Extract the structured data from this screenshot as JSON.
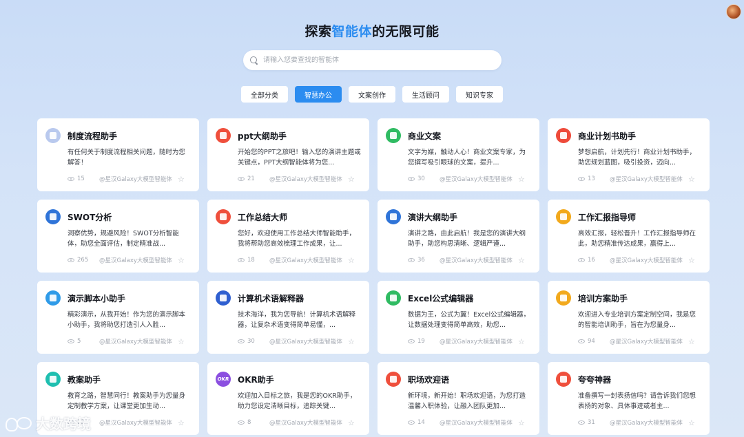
{
  "header": {
    "title_pre": "探索",
    "title_highlight": "智能体",
    "title_post": "的无限可能"
  },
  "search": {
    "placeholder": "请输入您要查找的智能体"
  },
  "tabs": [
    {
      "label": "全部分类",
      "active": false
    },
    {
      "label": "智慧办公",
      "active": true
    },
    {
      "label": "文案创作",
      "active": false
    },
    {
      "label": "生活顾问",
      "active": false
    },
    {
      "label": "知识专家",
      "active": false
    }
  ],
  "cards": [
    {
      "title": "制度流程助手",
      "desc": "有任何关于制度流程相关问题，随时为您解答！",
      "views": "15",
      "author": "@星汉Galaxy大模型智能体",
      "icon": "robot-icon",
      "color": "#b9c9ee"
    },
    {
      "title": "ppt大纲助手",
      "desc": "开始您的PPT之旅吧！输入您的演讲主题或关键点，PPT大纲智能体将为您...",
      "views": "21",
      "author": "@星汉Galaxy大模型智能体",
      "icon": "ppt-icon",
      "color": "#ef4f3c"
    },
    {
      "title": "商业文案",
      "desc": "文字为媒，触动人心！商业文案专家，为您撰写吸引眼球的文案，提升...",
      "views": "30",
      "author": "@星汉Galaxy大模型智能体",
      "icon": "edit-icon",
      "color": "#2fbb62"
    },
    {
      "title": "商业计划书助手",
      "desc": "梦想启航，计划先行！商业计划书助手，助您规划蓝图，吸引投资，迈向...",
      "views": "13",
      "author": "@星汉Galaxy大模型智能体",
      "icon": "chart-icon",
      "color": "#ee4a3a"
    },
    {
      "title": "SWOT分析",
      "desc": "洞察优势，规避风险！SWOT分析智能体，助您全面评估，制定精准战...",
      "views": "265",
      "author": "@星汉Galaxy大模型智能体",
      "icon": "target-icon",
      "color": "#2f74d8"
    },
    {
      "title": "工作总结大师",
      "desc": "您好，欢迎使用工作总结大师智能助手，我将帮助您高效梳理工作成果，让...",
      "views": "18",
      "author": "@星汉Galaxy大模型智能体",
      "icon": "summary-icon",
      "color": "#ef4f3c"
    },
    {
      "title": "演讲大纲助手",
      "desc": "演讲之路，由此启航！我是您的演讲大纲助手，助您构思清晰、逻辑严谨...",
      "views": "36",
      "author": "@星汉Galaxy大模型智能体",
      "icon": "briefcase-icon",
      "color": "#2f74d8"
    },
    {
      "title": "工作汇报指导师",
      "desc": "高效汇报，轻松晋升！工作汇报指导师在此，助您精准传达成果，赢得上...",
      "views": "16",
      "author": "@星汉Galaxy大模型智能体",
      "icon": "report-icon",
      "color": "#f2a91c"
    },
    {
      "title": "演示脚本小助手",
      "desc": "精彩演示，从我开始！作为您的演示脚本小助手，我将助您打造引人入胜...",
      "views": "5",
      "author": "@星汉Galaxy大模型智能体",
      "icon": "presentation-icon",
      "color": "#2f9be8"
    },
    {
      "title": "计算机术语解释器",
      "desc": "技术海洋，我为您导航！计算机术语解释器，让复杂术语变得简单易懂，...",
      "views": "30",
      "author": "@星汉Galaxy大模型智能体",
      "icon": "computer-icon",
      "color": "#2f5fd0"
    },
    {
      "title": "Excel公式编辑器",
      "desc": "数据为王，公式为翼！Excel公式编辑器，让数据处理变得简单高效，助您...",
      "views": "19",
      "author": "@星汉Galaxy大模型智能体",
      "icon": "excel-icon",
      "color": "#2fbb62"
    },
    {
      "title": "培训方案助手",
      "desc": "欢迎进入专业培训方案定制空间，我是您的智能培训助手，旨在为您量身...",
      "views": "94",
      "author": "@星汉Galaxy大模型智能体",
      "icon": "graduation-icon",
      "color": "#f2a91c"
    },
    {
      "title": "教案助手",
      "desc": "教育之路，智慧同行！教案助手为您量身定制教学方案，让课堂更加生动...",
      "views": "13",
      "author": "@星汉Galaxy大模型智能体",
      "icon": "lesson-icon",
      "color": "#1fbfb0"
    },
    {
      "title": "OKR助手",
      "desc": "欢迎加入目标之旅，我是您的OKR助手，助力您设定清晰目标，追踪关键...",
      "views": "8",
      "author": "@星汉Galaxy大模型智能体",
      "icon": "okr-icon",
      "color": "#8b4fe0",
      "badge": "OKR"
    },
    {
      "title": "职场欢迎语",
      "desc": "新环境，新开始！职场欢迎语，为您打造温馨入职体验，让融入团队更加...",
      "views": "14",
      "author": "@星汉Galaxy大模型智能体",
      "icon": "document-icon",
      "color": "#ef4f3c"
    },
    {
      "title": "夸夸神器",
      "desc": "准备撰写一封表扬信吗？请告诉我们您想表扬的对象、具体事迹或者主...",
      "views": "31",
      "author": "@星汉Galaxy大模型智能体",
      "icon": "thumbs-up-icon",
      "color": "#ef4f3c"
    }
  ],
  "watermark": {
    "text": "大数跨境"
  }
}
